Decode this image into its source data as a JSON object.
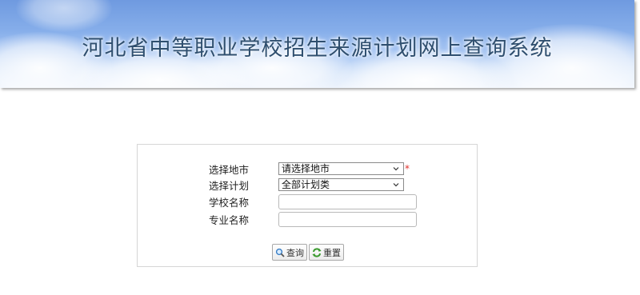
{
  "banner": {
    "title": "河北省中等职业学校招生来源计划网上查询系统"
  },
  "form": {
    "city_label": "选择地市",
    "city_value": "请选择地市",
    "city_required_mark": "*",
    "plan_label": "选择计划",
    "plan_value": "全部计划类",
    "school_label": "学校名称",
    "school_value": "",
    "major_label": "专业名称",
    "major_value": ""
  },
  "buttons": {
    "query_label": "查询",
    "reset_label": "重置"
  },
  "icons": {
    "query": "magnifier-icon",
    "reset": "refresh-icon"
  },
  "colors": {
    "banner_sky": "#86aeea",
    "title_text": "#2f4f6f",
    "required": "#e0302b",
    "panel_border": "#d6d6d6"
  }
}
